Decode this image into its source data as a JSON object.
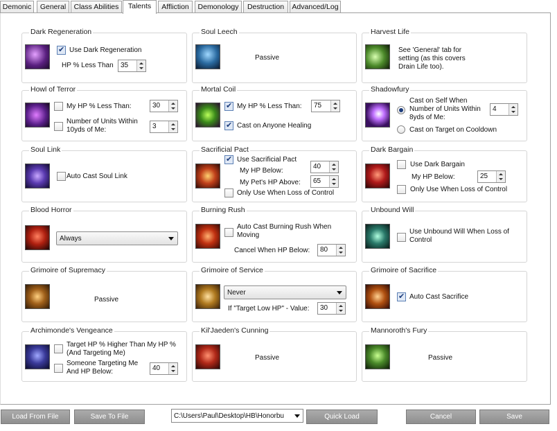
{
  "tabs": [
    "Demonic",
    "General",
    "Class Abilities",
    "Talents",
    "Affliction",
    "Demonology",
    "Destruction",
    "Advanced/Log"
  ],
  "active_tab": "Talents",
  "groups": {
    "dark_regeneration": {
      "title": "Dark Regeneration",
      "use_label": "Use Dark Regeneration",
      "use_checked": true,
      "hp_label": "HP % Less Than",
      "hp_value": "35"
    },
    "soul_leech": {
      "title": "Soul Leech",
      "passive": "Passive"
    },
    "harvest_life": {
      "title": "Harvest Life",
      "note": "See 'General' tab for setting (as this covers Drain Life too)."
    },
    "howl_of_terror": {
      "title": "Howl of Terror",
      "hp_label": "My HP % Less Than:",
      "hp_value": "30",
      "units_label": "Number of Units Within 10yds of Me:",
      "units_value": "3"
    },
    "mortal_coil": {
      "title": "Mortal Coil",
      "hp_label": "My HP % Less Than:",
      "hp_value": "75",
      "cast_label": "Cast on Anyone Healing"
    },
    "shadowfury": {
      "title": "Shadowfury",
      "self_label": "Cast on Self When Number of Units Within 8yds of Me:",
      "self_value": "4",
      "target_label": "Cast on Target on Cooldown"
    },
    "soul_link": {
      "title": "Soul Link",
      "auto_label": "Auto Cast Soul Link"
    },
    "sacrificial_pact": {
      "title": "Sacrificial Pact",
      "use_label": "Use Sacrificial Pact",
      "hp_label": "My HP Below:",
      "hp_value": "40",
      "pet_label": "My Pet's HP Above:",
      "pet_value": "65",
      "loss_label": "Only Use When Loss of Control"
    },
    "dark_bargain": {
      "title": "Dark Bargain",
      "use_label": "Use Dark Bargain",
      "hp_label": "My HP Below:",
      "hp_value": "25",
      "loss_label": "Only Use When Loss of Control"
    },
    "blood_horror": {
      "title": "Blood Horror",
      "select": "Always"
    },
    "burning_rush": {
      "title": "Burning Rush",
      "auto_label": "Auto Cast Burning Rush When Moving",
      "cancel_label": "Cancel When HP Below:",
      "cancel_value": "80"
    },
    "unbound_will": {
      "title": "Unbound Will",
      "use_label": "Use Unbound Will When Loss of Control"
    },
    "grimoire_supremacy": {
      "title": "Grimoire of Supremacy",
      "passive": "Passive"
    },
    "grimoire_service": {
      "title": "Grimoire of Service",
      "select": "Never",
      "value_label": "If \"Target Low HP\" - Value:",
      "value": "30"
    },
    "grimoire_sacrifice": {
      "title": "Grimoire of Sacrifice",
      "auto_label": "Auto Cast Sacrifice"
    },
    "archimondes_vengeance": {
      "title": "Archimonde's Vengeance",
      "target_label": "Target HP % Higher Than My HP % (And Targeting Me)",
      "someone_label": "Someone Targeting Me And HP Below:",
      "someone_value": "40"
    },
    "kiljaedens_cunning": {
      "title": "Kil'Jaeden's Cunning",
      "passive": "Passive"
    },
    "mannoroths_fury": {
      "title": "Mannoroth's Fury",
      "passive": "Passive"
    }
  },
  "footer": {
    "load_file": "Load From File",
    "save_file": "Save To File",
    "path": "C:\\Users\\Paul\\Desktop\\HB\\Honorbu",
    "quick_load": "Quick Load",
    "cancel": "Cancel",
    "save": "Save"
  }
}
